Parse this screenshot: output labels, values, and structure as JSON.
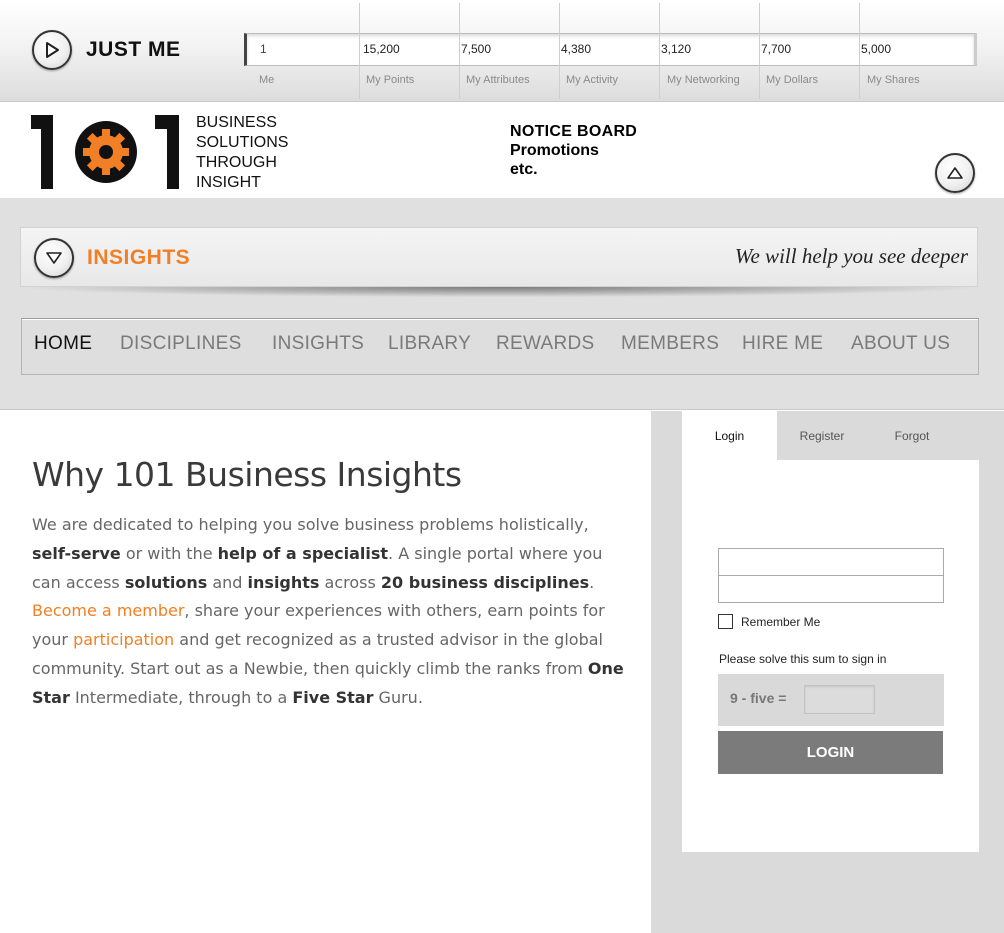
{
  "user_bar": {
    "title": "JUST ME",
    "stats": [
      {
        "value": "1",
        "label": "Me"
      },
      {
        "value": "15,200",
        "label": "My Points"
      },
      {
        "value": "7,500",
        "label": "My Attributes"
      },
      {
        "value": "4,380",
        "label": "My Activity"
      },
      {
        "value": "3,120",
        "label": "My Networking"
      },
      {
        "value": "7,700",
        "label": "My Dollars"
      },
      {
        "value": "5,000",
        "label": "My Shares"
      }
    ]
  },
  "brand": {
    "logo_text": "101",
    "tagline": [
      "BUSINESS",
      "SOLUTIONS",
      "THROUGH",
      "INSIGHT"
    ],
    "logo_color": "#f07f25"
  },
  "notice_board": {
    "title": "NOTICE BOARD",
    "lines": [
      "Promotions",
      "etc."
    ]
  },
  "insights_banner": {
    "title": "INSIGHTS",
    "motto": "We will help you see deeper"
  },
  "nav": {
    "items": [
      "HOME",
      "DISCIPLINES",
      "INSIGHTS",
      "LIBRARY",
      "REWARDS",
      "MEMBERS",
      "HIRE ME",
      "ABOUT US"
    ],
    "active": "HOME"
  },
  "main": {
    "heading": "Why 101 Business Insights",
    "p": {
      "t1": "We are dedicated to helping you solve business problems holistically,",
      "b1": "self-serve",
      "t2": " or with the ",
      "b2": "help of a specialist",
      "t3": ". A single portal where you can access ",
      "b3": "solutions",
      "t4": " and ",
      "b4": "insights",
      "t5": " across ",
      "b5": "20 business disciplines",
      "t6": ". ",
      "l1": "Become a member",
      "t7": ", share your experiences with others, earn points for your ",
      "l2": "participation",
      "t8": " and get recognized as a trusted advisor in the global community. Start out as a Newbie, then quickly climb the ranks from ",
      "b6": "One Star",
      "t9": " Intermediate, through to a ",
      "b7": "Five Star",
      "t10": " Guru."
    }
  },
  "login": {
    "tabs": [
      "Login",
      "Register",
      "Forgot"
    ],
    "active_tab": "Login",
    "remember_label": "Remember Me",
    "sum_label": "Please solve this sum to sign in",
    "sum_question": "9 - five =",
    "button": "LOGIN"
  },
  "colors": {
    "accent": "#f07f25",
    "button": "#7b7b7b",
    "band": "#e0e0e0"
  }
}
